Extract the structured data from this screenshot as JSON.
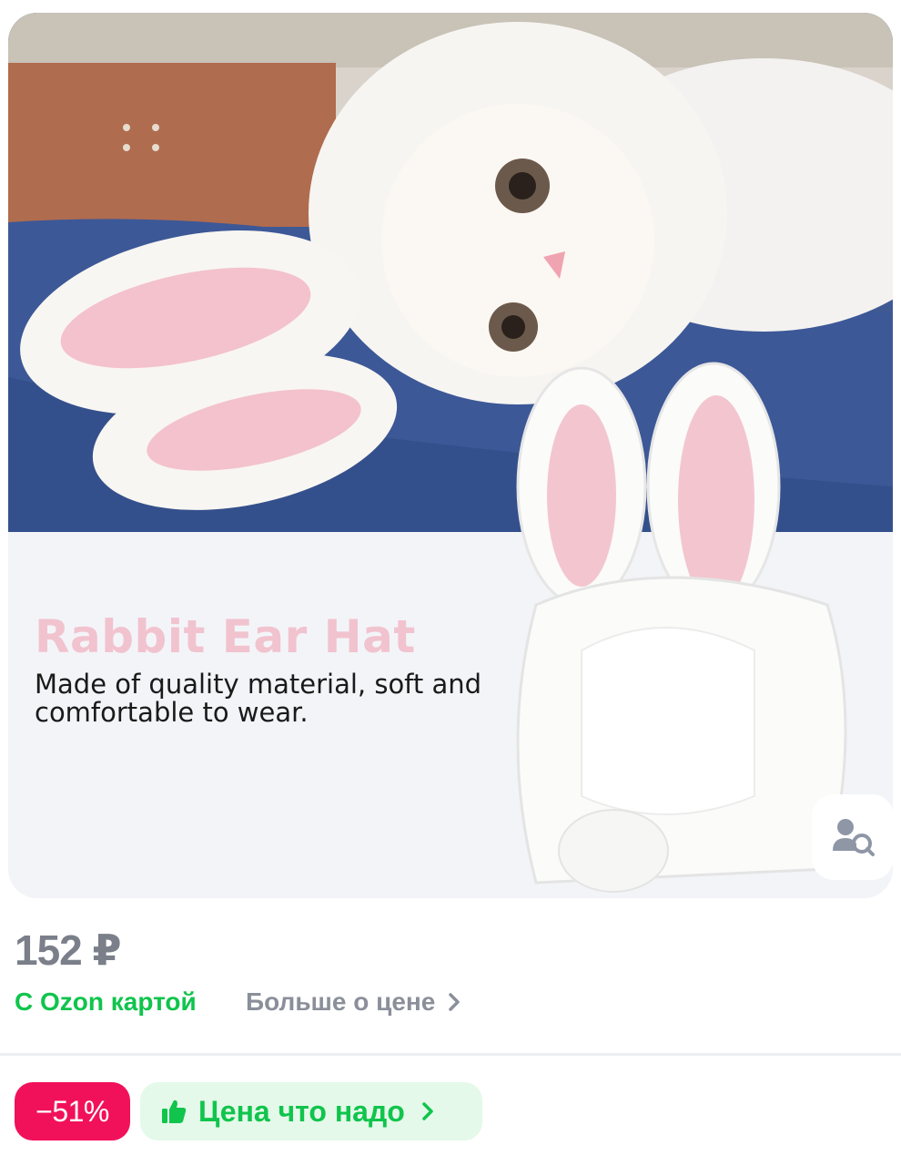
{
  "product_image": {
    "promo_title": "Rabbit Ear Hat",
    "promo_text": "Made of quality material, soft and comfortable to wear.",
    "search_icon": "image-search-icon"
  },
  "pricing": {
    "price": "152 ₽",
    "card_label": "С Ozon картой",
    "more_label": "Больше о цене",
    "more_icon": "chevron-right-icon"
  },
  "badges": {
    "discount": "−51%",
    "price_tag": "Цена что надо",
    "price_tag_icon": "thumbs-up-icon",
    "price_tag_chevron": "chevron-right-icon"
  },
  "colors": {
    "ozon_green": "#10c44c",
    "discount_red": "#f1115a",
    "price_grey": "#7a7f8a"
  }
}
